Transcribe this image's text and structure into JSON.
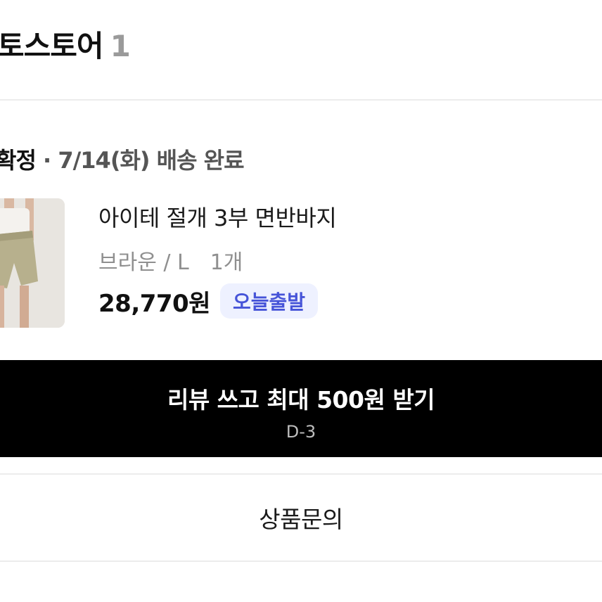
{
  "store": {
    "name": "토스토어",
    "count": "1"
  },
  "delivery": {
    "status": "확정",
    "detail": "· 7/14(화) 배송 완료"
  },
  "product": {
    "thumbnail_icon": "product-photo-shorts",
    "name": "아이테 절개 3부 면반바지",
    "option": "브라운 / L",
    "quantity": "1개",
    "price": "28,770원",
    "badge": "오늘출발",
    "badge_color": "#4654d8",
    "badge_bg": "#eef1ff"
  },
  "review_button": {
    "label": "리뷰 쓰고 최대 500원 받기",
    "deadline": "D-3"
  },
  "inquiry_button": {
    "label": "상품문의"
  }
}
